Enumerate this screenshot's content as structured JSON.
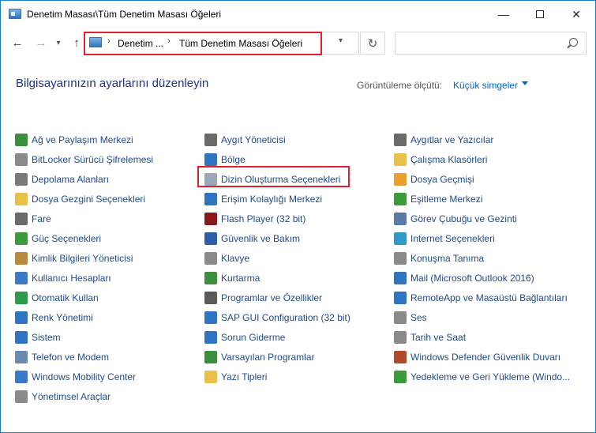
{
  "window": {
    "title": "Denetim Masası\\Tüm Denetim Masası Öğeleri",
    "minimize_glyph": "—",
    "close_glyph": "✕"
  },
  "toolbar": {
    "back_glyph": "←",
    "forward_glyph": "→",
    "recent_glyph": "▾",
    "up_glyph": "↑",
    "breadcrumb": [
      "Denetim ...",
      "Tüm Denetim Masası Öğeleri"
    ],
    "separator_glyph": "›",
    "dropdown_glyph": "▾",
    "refresh_glyph": "↻",
    "search_placeholder": ""
  },
  "main": {
    "heading": "Bilgisayarınızın ayarlarını düzenleyin",
    "view_by_label": "Görüntüleme ölçütü:",
    "view_by_value": "Küçük simgeler"
  },
  "columns": [
    [
      {
        "label": "Ağ ve Paylaşım Merkezi",
        "icon": "network-icon",
        "color": "#3c8d3c"
      },
      {
        "label": "BitLocker Sürücü Şifrelemesi",
        "icon": "bitlocker-icon",
        "color": "#8a8a8a"
      },
      {
        "label": "Depolama Alanları",
        "icon": "storage-icon",
        "color": "#7a7a7a"
      },
      {
        "label": "Dosya Gezgini Seçenekleri",
        "icon": "folder-options-icon",
        "color": "#e8c04a"
      },
      {
        "label": "Fare",
        "icon": "mouse-icon",
        "color": "#6a6a6a"
      },
      {
        "label": "Güç Seçenekleri",
        "icon": "power-icon",
        "color": "#3c9a3c"
      },
      {
        "label": "Kimlik Bilgileri Yöneticisi",
        "icon": "credentials-icon",
        "color": "#b58a3c"
      },
      {
        "label": "Kullanıcı Hesapları",
        "icon": "users-icon",
        "color": "#3c7ac8"
      },
      {
        "label": "Otomatik Kullan",
        "icon": "autoplay-icon",
        "color": "#2e9a4a"
      },
      {
        "label": "Renk Yönetimi",
        "icon": "color-management-icon",
        "color": "#2f74c0"
      },
      {
        "label": "Sistem",
        "icon": "system-icon",
        "color": "#2f74c0"
      },
      {
        "label": "Telefon ve Modem",
        "icon": "phone-modem-icon",
        "color": "#6a8ab0"
      },
      {
        "label": "Windows Mobility Center",
        "icon": "mobility-icon",
        "color": "#3c7ac8"
      },
      {
        "label": "Yönetimsel Araçlar",
        "icon": "admin-tools-icon",
        "color": "#8a8a8a"
      }
    ],
    [
      {
        "label": "Aygıt Yöneticisi",
        "icon": "device-manager-icon",
        "color": "#6a6a6a"
      },
      {
        "label": "Bölge",
        "icon": "region-icon",
        "color": "#2f74c0"
      },
      {
        "label": "Dizin Oluşturma Seçenekleri",
        "icon": "indexing-icon",
        "color": "#9aa8b8"
      },
      {
        "label": "Erişim Kolaylığı Merkezi",
        "icon": "ease-of-access-icon",
        "color": "#2f74c0"
      },
      {
        "label": "Flash Player (32 bit)",
        "icon": "flash-icon",
        "color": "#8b1a1a"
      },
      {
        "label": "Güvenlik ve Bakım",
        "icon": "flag-icon",
        "color": "#2f5ea8"
      },
      {
        "label": "Klavye",
        "icon": "keyboard-icon",
        "color": "#8a8a8a"
      },
      {
        "label": "Kurtarma",
        "icon": "recovery-icon",
        "color": "#3c8d3c"
      },
      {
        "label": "Programlar ve Özellikler",
        "icon": "programs-icon",
        "color": "#5a5a5a"
      },
      {
        "label": "SAP GUI Configuration (32 bit)",
        "icon": "sap-icon",
        "color": "#2f74c0"
      },
      {
        "label": "Sorun Giderme",
        "icon": "troubleshoot-icon",
        "color": "#2f74c0"
      },
      {
        "label": "Varsayılan Programlar",
        "icon": "default-programs-icon",
        "color": "#3c8d3c"
      },
      {
        "label": "Yazı Tipleri",
        "icon": "fonts-icon",
        "color": "#e8c04a"
      }
    ],
    [
      {
        "label": "Aygıtlar ve Yazıcılar",
        "icon": "printer-icon",
        "color": "#6a6a6a"
      },
      {
        "label": "Çalışma Klasörleri",
        "icon": "work-folders-icon",
        "color": "#e8c04a"
      },
      {
        "label": "Dosya Geçmişi",
        "icon": "file-history-icon",
        "color": "#e8a030"
      },
      {
        "label": "Eşitleme Merkezi",
        "icon": "sync-icon",
        "color": "#3c9a3c"
      },
      {
        "label": "Görev Çubuğu ve Gezinti",
        "icon": "taskbar-icon",
        "color": "#5a7aa8"
      },
      {
        "label": "Internet Seçenekleri",
        "icon": "internet-options-icon",
        "color": "#2f9ac8"
      },
      {
        "label": "Konuşma Tanıma",
        "icon": "microphone-icon",
        "color": "#8a8a8a"
      },
      {
        "label": "Mail (Microsoft Outlook 2016)",
        "icon": "mail-icon",
        "color": "#2f74c0"
      },
      {
        "label": "RemoteApp ve Masaüstü Bağlantıları",
        "icon": "remoteapp-icon",
        "color": "#2f74c0"
      },
      {
        "label": "Ses",
        "icon": "speaker-icon",
        "color": "#8a8a8a"
      },
      {
        "label": "Tarih ve Saat",
        "icon": "clock-icon",
        "color": "#8a8a8a"
      },
      {
        "label": "Windows Defender Güvenlik Duvarı",
        "icon": "firewall-icon",
        "color": "#b04a2a"
      },
      {
        "label": "Yedekleme ve Geri Yükleme (Windo...",
        "icon": "backup-icon",
        "color": "#3c9a3c"
      }
    ]
  ]
}
